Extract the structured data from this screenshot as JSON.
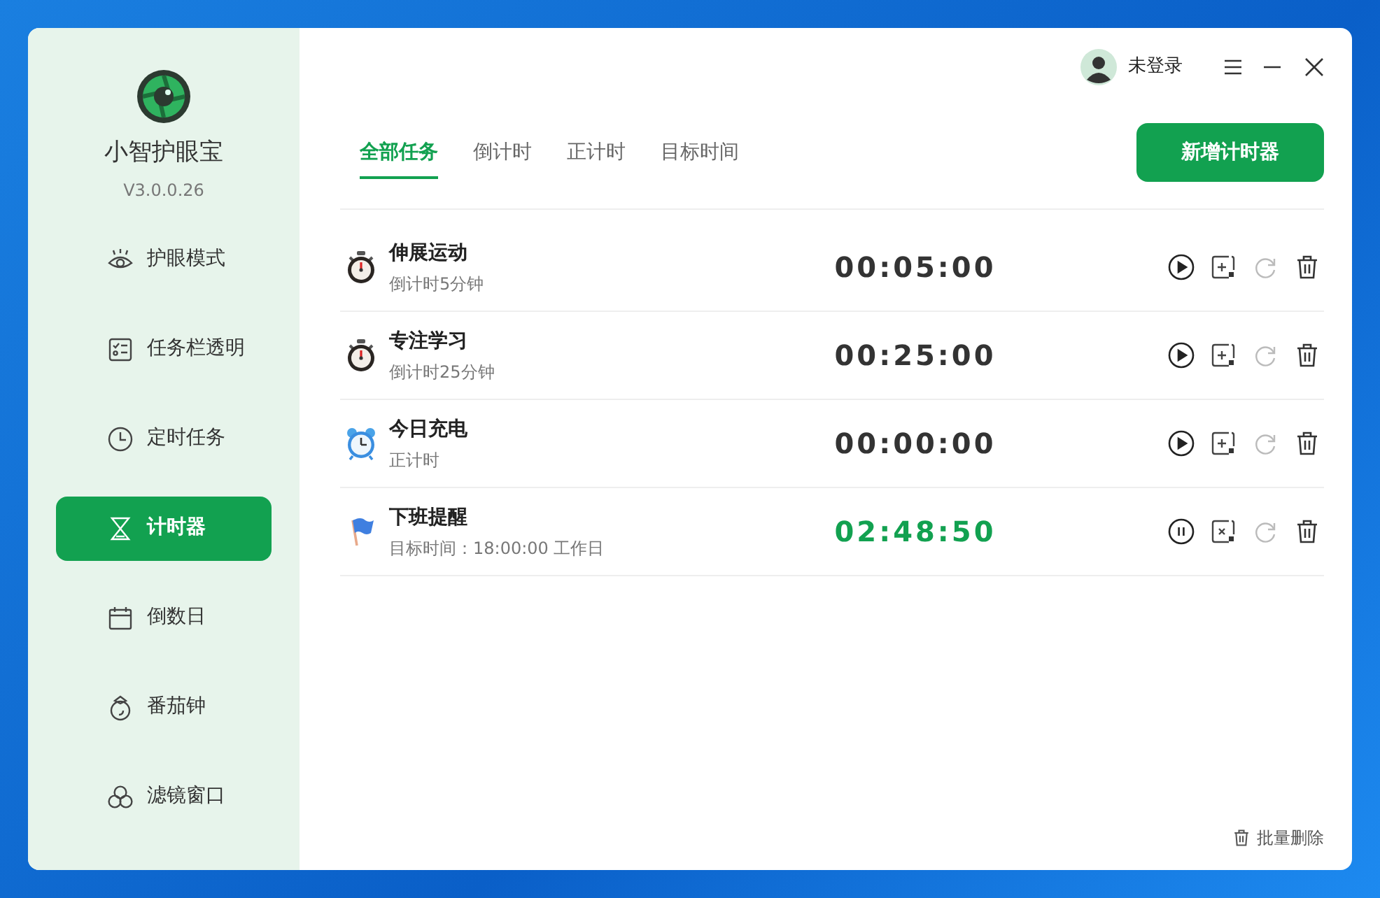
{
  "app": {
    "name": "小智护眼宝",
    "version": "V3.0.0.26"
  },
  "sidebar": {
    "items": [
      {
        "label": "护眼模式",
        "kind": "eye",
        "selected": false
      },
      {
        "label": "任务栏透明",
        "kind": "checklist",
        "selected": false
      },
      {
        "label": "定时任务",
        "kind": "clock",
        "selected": false
      },
      {
        "label": "计时器",
        "kind": "hourglass",
        "selected": true
      },
      {
        "label": "倒数日",
        "kind": "calendar",
        "selected": false
      },
      {
        "label": "番茄钟",
        "kind": "tomato",
        "selected": false
      },
      {
        "label": "滤镜窗口",
        "kind": "circles",
        "selected": false
      }
    ]
  },
  "user": {
    "label": "未登录"
  },
  "tabs": [
    {
      "label": "全部任务",
      "selected": true
    },
    {
      "label": "倒计时",
      "selected": false
    },
    {
      "label": "正计时",
      "selected": false
    },
    {
      "label": "目标时间",
      "selected": false
    }
  ],
  "add_button": "新增计时器",
  "timers": [
    {
      "kind": "stopwatch",
      "name": "伸展运动",
      "subtitle": "倒计时5分钟",
      "time": "00:05:00",
      "running": false,
      "reset_disabled": true
    },
    {
      "kind": "stopwatch",
      "name": "专注学习",
      "subtitle": "倒计时25分钟",
      "time": "00:25:00",
      "running": false,
      "reset_disabled": true
    },
    {
      "kind": "alarm",
      "name": "今日充电",
      "subtitle": "正计时",
      "time": "00:00:00",
      "running": false,
      "reset_disabled": true
    },
    {
      "kind": "flag",
      "name": "下班提醒",
      "subtitle": "目标时间：18:00:00 工作日",
      "time": "02:48:50",
      "running": true,
      "reset_disabled": true
    }
  ],
  "bulk_delete": "批量删除"
}
